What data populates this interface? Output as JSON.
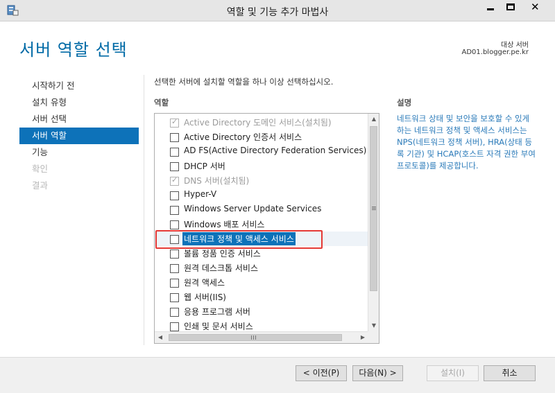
{
  "window": {
    "title": "역할 및 기능 추가 마법사",
    "close_glyph": "✕"
  },
  "header": {
    "page_title": "서버 역할 선택",
    "destination_label": "대상 서버",
    "destination_server": "AD01.blogger.pe.kr"
  },
  "nav": {
    "items": [
      {
        "label": "시작하기 전",
        "state": "normal"
      },
      {
        "label": "설치 유형",
        "state": "normal"
      },
      {
        "label": "서버 선택",
        "state": "normal"
      },
      {
        "label": "서버 역할",
        "state": "active"
      },
      {
        "label": "기능",
        "state": "normal"
      },
      {
        "label": "확인",
        "state": "disabled"
      },
      {
        "label": "결과",
        "state": "disabled"
      }
    ]
  },
  "main": {
    "instruction": "선택한 서버에 설치할 역할을 하나 이상 선택하십시오.",
    "roles_heading": "역할",
    "description_heading": "설명",
    "description_text": "네트워크 상태 및 보안을 보호할 수 있게 하는 네트워크 정책 및 액세스 서비스는 NPS(네트워크 정책 서버), HRA(상태 등록 기관) 및 HCAP(호스트 자격 권한 부여 프로토콜)를 제공합니다.",
    "roles": [
      {
        "label": "Active Directory 도메인 서비스(설치됨)",
        "checked": true,
        "installed": true,
        "selected": false
      },
      {
        "label": "Active Directory 인증서 서비스",
        "checked": false,
        "installed": false,
        "selected": false
      },
      {
        "label": "AD FS(Active Directory Federation Services)",
        "checked": false,
        "installed": false,
        "selected": false
      },
      {
        "label": "DHCP 서버",
        "checked": false,
        "installed": false,
        "selected": false
      },
      {
        "label": "DNS 서버(설치됨)",
        "checked": true,
        "installed": true,
        "selected": false
      },
      {
        "label": "Hyper-V",
        "checked": false,
        "installed": false,
        "selected": false
      },
      {
        "label": "Windows Server Update Services",
        "checked": false,
        "installed": false,
        "selected": false
      },
      {
        "label": "Windows 배포 서비스",
        "checked": false,
        "installed": false,
        "selected": false
      },
      {
        "label": "네트워크 정책 및 액세스 서비스",
        "checked": false,
        "installed": false,
        "selected": true
      },
      {
        "label": "볼륨 정품 인증 서비스",
        "checked": false,
        "installed": false,
        "selected": false
      },
      {
        "label": "원격 데스크톱 서비스",
        "checked": false,
        "installed": false,
        "selected": false
      },
      {
        "label": "원격 액세스",
        "checked": false,
        "installed": false,
        "selected": false
      },
      {
        "label": "웹 서버(IIS)",
        "checked": false,
        "installed": false,
        "selected": false
      },
      {
        "label": "응용 프로그램 서버",
        "checked": false,
        "installed": false,
        "selected": false
      },
      {
        "label": "인쇄 및 문서 서비스",
        "checked": false,
        "installed": false,
        "selected": false
      }
    ],
    "check_glyph": "✓"
  },
  "footer": {
    "prev_label": "< 이전(P)",
    "next_label": "다음(N) >",
    "install_label": "설치(I)",
    "cancel_label": "취소"
  },
  "colors": {
    "accent": "#0d72b9",
    "title_blue": "#006aa6",
    "highlight_border": "#e53935"
  }
}
